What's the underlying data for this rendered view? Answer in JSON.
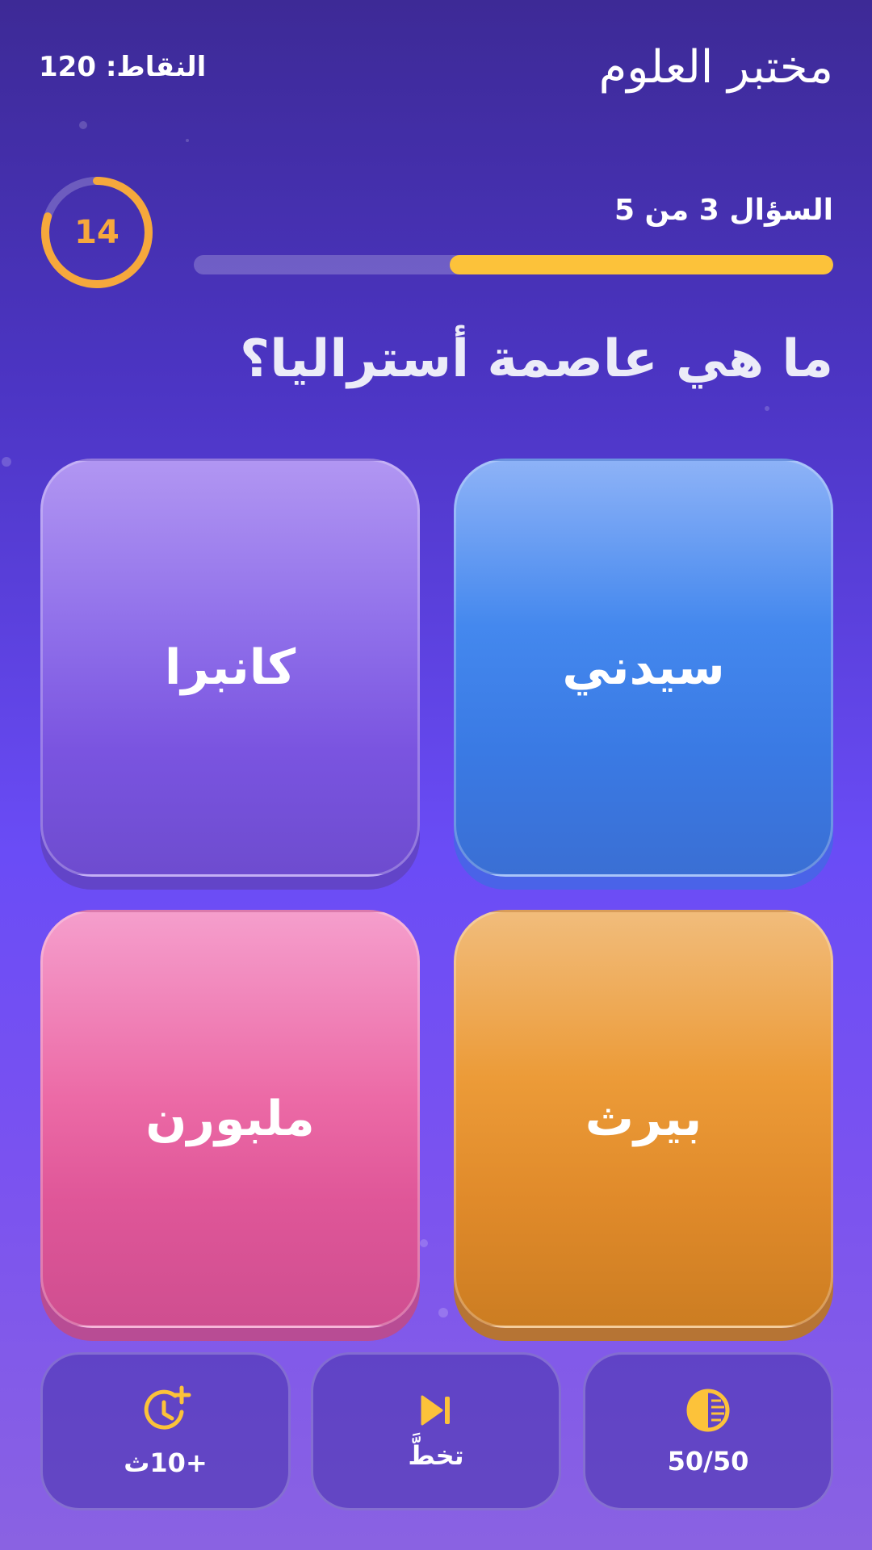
{
  "header": {
    "app_title": "مختبر العلوم",
    "score": "النقاط: 120"
  },
  "timer": {
    "seconds": "14",
    "remaining_fraction": 0.8,
    "color": "#f6a83c"
  },
  "question_counter": "السؤال 3 من 5",
  "progress": {
    "fraction": 0.6,
    "color": "#fcc23a"
  },
  "question": "ما هي عاصمة أستراليا؟",
  "answers": [
    {
      "label": "سيدني",
      "color": "#3a7ae4"
    },
    {
      "label": "كانبرا",
      "color": "#7a54e0"
    },
    {
      "label": "بيرث",
      "color": "#e08a2a"
    },
    {
      "label": "ملبورن",
      "color": "#df5698"
    }
  ],
  "lifelines": [
    {
      "label": "50/50",
      "icon": "half-circle-icon"
    },
    {
      "label": "تخطَّ",
      "icon": "skip-icon"
    },
    {
      "label": "+10ث",
      "icon": "clock-plus-icon"
    }
  ],
  "accent_color": "#fcc23a"
}
